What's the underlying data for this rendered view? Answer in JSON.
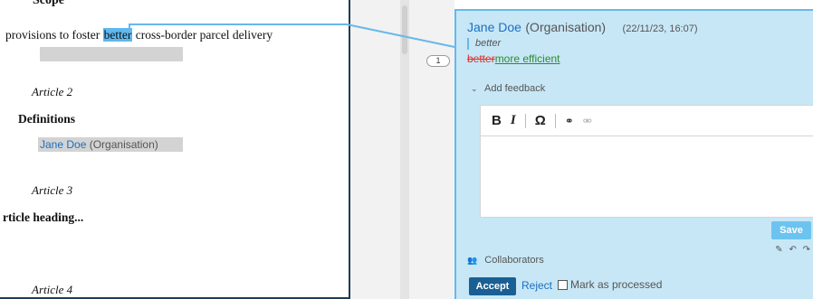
{
  "document": {
    "scope_heading": "Scope",
    "provisions_before": "provisions to foster ",
    "provisions_highlight": "better",
    "provisions_after": " cross-border parcel delivery",
    "article2": "Article 2",
    "definitions": "Definitions",
    "marker_author": "Jane Doe",
    "marker_org": "(Organisation)",
    "article3": "Article 3",
    "article_heading": "rticle heading...",
    "article4": "Article 4"
  },
  "gutter": {
    "comment_count": "1"
  },
  "comment": {
    "author": "Jane Doe",
    "org": "(Organisation)",
    "timestamp": "(22/11/23, 16:07)",
    "quoted_text": "better",
    "deleted_text": "better",
    "inserted_text": "more efficient",
    "add_feedback_label": "Add feedback",
    "toolbar": {
      "bold": "B",
      "italic": "I",
      "special_char": "Ω",
      "link": "⚭",
      "unlink": "⚮"
    },
    "save_label": "Save",
    "collaborators_label": "Collaborators",
    "accept_label": "Accept",
    "reject_label": "Reject",
    "mark_processed_label": "Mark as processed"
  },
  "colors": {
    "card_bg": "#c7e7f6",
    "card_border": "#66b8ea",
    "author_blue": "#1c6fc0",
    "accept_bg": "#1a5f93",
    "save_bg": "#6cc3ef",
    "deleted_red": "#d9322d",
    "inserted_green": "#2e8b2e",
    "highlight": "#5fb8ee"
  }
}
